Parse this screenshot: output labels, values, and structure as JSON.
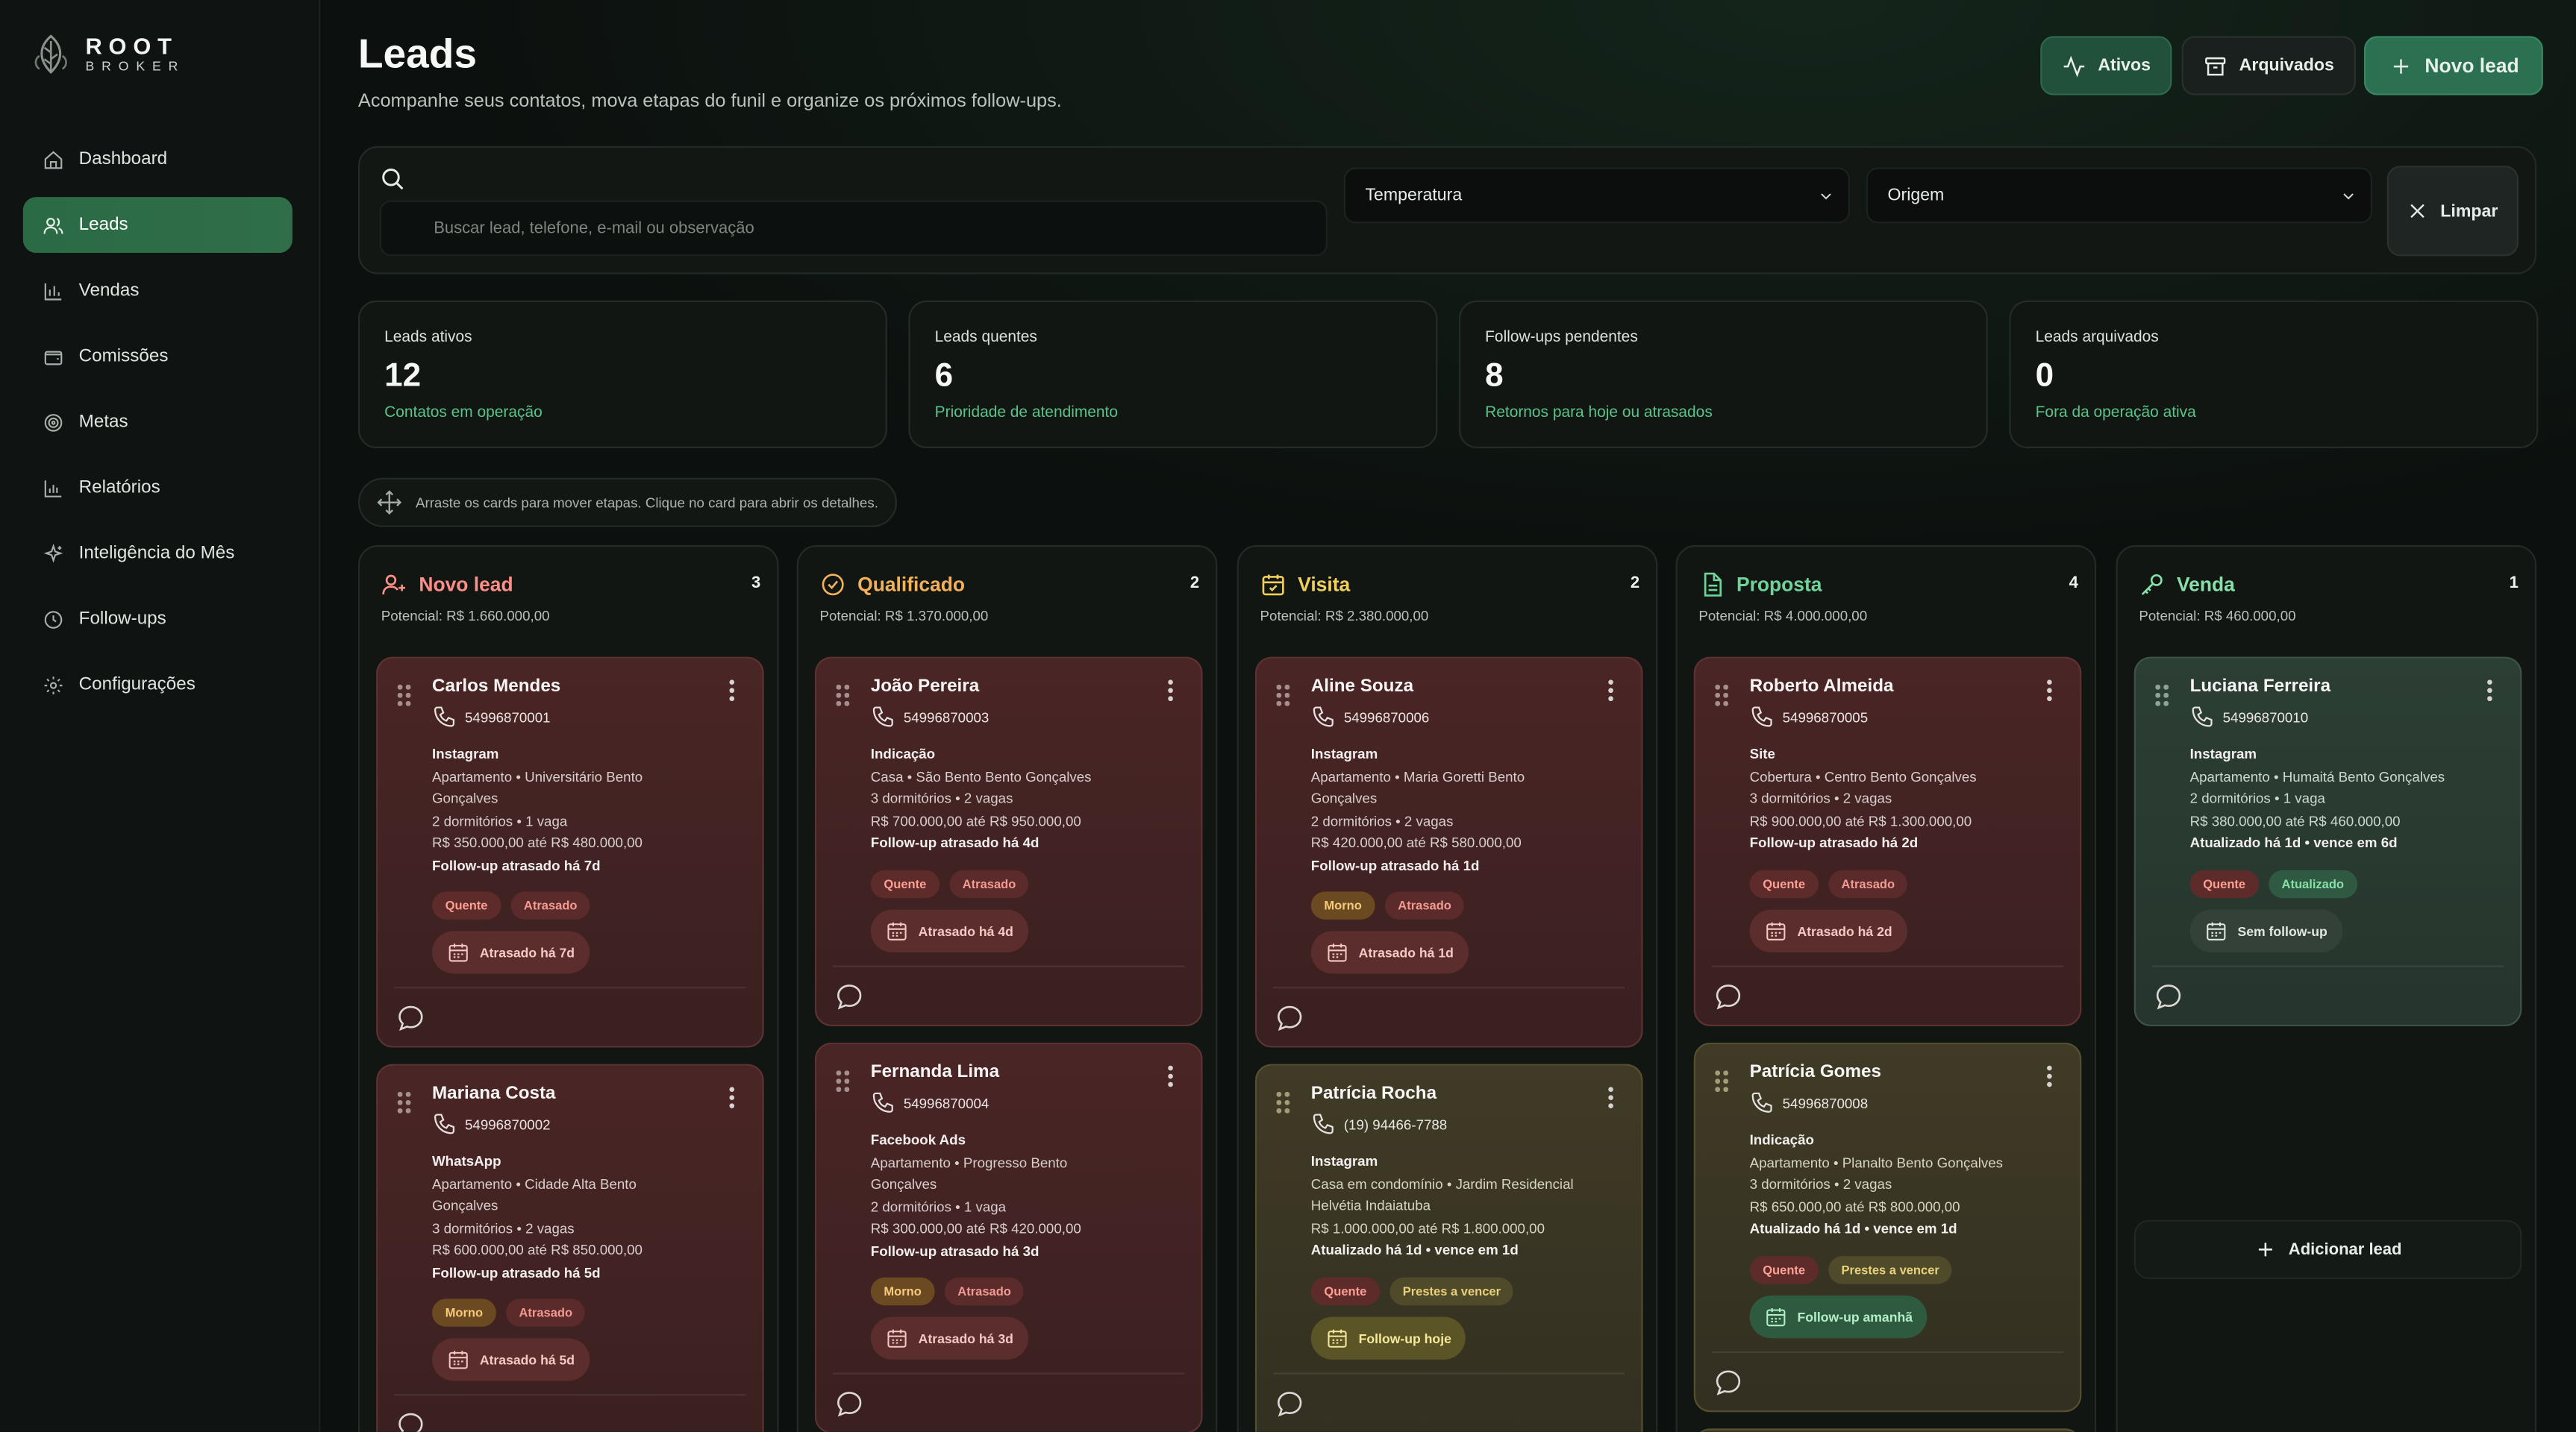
{
  "brand": {
    "name": "ROOT",
    "sub": "BROKER"
  },
  "sidebar": {
    "items": [
      {
        "label": "Dashboard",
        "icon": "home-icon"
      },
      {
        "label": "Leads",
        "icon": "users-icon",
        "active": true
      },
      {
        "label": "Vendas",
        "icon": "bar-chart-icon"
      },
      {
        "label": "Comissões",
        "icon": "wallet-icon"
      },
      {
        "label": "Metas",
        "icon": "target-icon"
      },
      {
        "label": "Relatórios",
        "icon": "report-icon"
      },
      {
        "label": "Inteligência do Mês",
        "icon": "sparkles-icon"
      },
      {
        "label": "Follow-ups",
        "icon": "clock-icon"
      },
      {
        "label": "Configurações",
        "icon": "gear-icon"
      }
    ]
  },
  "header": {
    "title": "Leads",
    "subtitle": "Acompanhe seus contatos, mova etapas do funil e organize os próximos follow-ups.",
    "btn_ativos": "Ativos",
    "btn_arquivados": "Arquivados",
    "btn_novo": "Novo lead"
  },
  "filters": {
    "search_placeholder": "Buscar lead, telefone, e-mail ou observação",
    "temperatura": "Temperatura",
    "origem": "Origem",
    "limpar": "Limpar"
  },
  "stats": [
    {
      "label": "Leads ativos",
      "value": "12",
      "sub": "Contatos em operação"
    },
    {
      "label": "Leads quentes",
      "value": "6",
      "sub": "Prioridade de atendimento"
    },
    {
      "label": "Follow-ups pendentes",
      "value": "8",
      "sub": "Retornos para hoje ou atrasados"
    },
    {
      "label": "Leads arquivados",
      "value": "0",
      "sub": "Fora da operação ativa"
    }
  ],
  "hint": "Arraste os cards para mover etapas. Clique no card para abrir os detalhes.",
  "colors": {
    "accent": "#2b7050",
    "novo": "#ff8f86",
    "qualificado": "#f3b15a",
    "visita": "#f0cf5c",
    "proposta": "#6fd39a",
    "venda": "#86e0a8"
  },
  "columns": [
    {
      "title": "Novo lead",
      "count": "3",
      "potential": "Potencial: R$ 1.660.000,00",
      "cards": [
        {
          "name": "Carlos Mendes",
          "phone": "54996870001",
          "source": "Instagram",
          "details": [
            "Apartamento • Universitário Bento",
            "Gonçalves",
            "2 dormitórios • 1 vaga",
            "R$ 350.000,00 até R$ 480.000,00"
          ],
          "followup": "Follow-up atrasado há 7d",
          "tags": [
            "Quente",
            "Atrasado"
          ],
          "button": "Atrasado há 7d"
        },
        {
          "name": "Mariana Costa",
          "phone": "54996870002",
          "source": "WhatsApp",
          "details": [
            "Apartamento • Cidade Alta Bento",
            "Gonçalves",
            "3 dormitórios • 2 vagas",
            "R$ 600.000,00 até R$ 850.000,00"
          ],
          "followup": "Follow-up atrasado há 5d",
          "tags": [
            "Morno",
            "Atrasado"
          ],
          "button": "Atrasado há 5d"
        }
      ]
    },
    {
      "title": "Qualificado",
      "count": "2",
      "potential": "Potencial: R$ 1.370.000,00",
      "cards": [
        {
          "name": "João Pereira",
          "phone": "54996870003",
          "source": "Indicação",
          "details": [
            "Casa • São Bento Bento Gonçalves",
            "3 dormitórios • 2 vagas",
            "R$ 700.000,00 até R$ 950.000,00"
          ],
          "followup": "Follow-up atrasado há 4d",
          "tags": [
            "Quente",
            "Atrasado"
          ],
          "button": "Atrasado há 4d"
        },
        {
          "name": "Fernanda Lima",
          "phone": "54996870004",
          "source": "Facebook Ads",
          "details": [
            "Apartamento • Progresso Bento",
            "Gonçalves",
            "2 dormitórios • 1 vaga",
            "R$ 300.000,00 até R$ 420.000,00"
          ],
          "followup": "Follow-up atrasado há 3d",
          "tags": [
            "Morno",
            "Atrasado"
          ],
          "button": "Atrasado há 3d"
        }
      ]
    },
    {
      "title": "Visita",
      "count": "2",
      "potential": "Potencial: R$ 2.380.000,00",
      "cards": [
        {
          "name": "Aline Souza",
          "phone": "54996870006",
          "source": "Instagram",
          "details": [
            "Apartamento • Maria Goretti Bento",
            "Gonçalves",
            "2 dormitórios • 2 vagas",
            "R$ 420.000,00 até R$ 580.000,00"
          ],
          "followup": "Follow-up atrasado há 1d",
          "tags": [
            "Morno",
            "Atrasado"
          ],
          "button": "Atrasado há 1d"
        },
        {
          "name": "Patrícia Rocha",
          "phone": "(19) 94466-7788",
          "source": "Instagram",
          "details": [
            "Casa em condomínio • Jardim Residencial",
            "Helvétia Indaiatuba",
            "R$ 1.000.000,00 até R$ 1.800.000,00"
          ],
          "followup": "Atualizado há 1d • vence em 1d",
          "tags": [
            "Quente",
            "Prestes a vencer"
          ],
          "button": "Follow-up hoje"
        }
      ]
    },
    {
      "title": "Proposta",
      "count": "4",
      "potential": "Potencial: R$ 4.000.000,00",
      "cards": [
        {
          "name": "Roberto Almeida",
          "phone": "54996870005",
          "source": "Site",
          "details": [
            "Cobertura • Centro Bento Gonçalves",
            "3 dormitórios • 2 vagas",
            "R$ 900.000,00 até R$ 1.300.000,00"
          ],
          "followup": "Follow-up atrasado há 2d",
          "tags": [
            "Quente",
            "Atrasado"
          ],
          "button": "Atrasado há 2d"
        },
        {
          "name": "Patrícia Gomes",
          "phone": "54996870008",
          "source": "Indicação",
          "details": [
            "Apartamento • Planalto Bento Gonçalves",
            "3 dormitórios • 2 vagas",
            "R$ 650.000,00 até R$ 800.000,00"
          ],
          "followup": "Atualizado há 1d • vence em 1d",
          "tags": [
            "Quente",
            "Prestes a vencer"
          ],
          "button": "Follow-up amanhã"
        }
      ]
    },
    {
      "title": "Venda",
      "count": "1",
      "potential": "Potencial: R$ 460.000,00",
      "cards": [
        {
          "name": "Luciana Ferreira",
          "phone": "54996870010",
          "source": "Instagram",
          "details": [
            "Apartamento • Humaitá Bento Gonçalves",
            "2 dormitórios • 1 vaga",
            "R$ 380.000,00 até R$ 460.000,00"
          ],
          "followup": "Atualizado há 1d • vence em 6d",
          "tags": [
            "Quente",
            "Atualizado"
          ],
          "button": "Sem follow-up"
        }
      ],
      "add_label": "Adicionar lead"
    }
  ]
}
